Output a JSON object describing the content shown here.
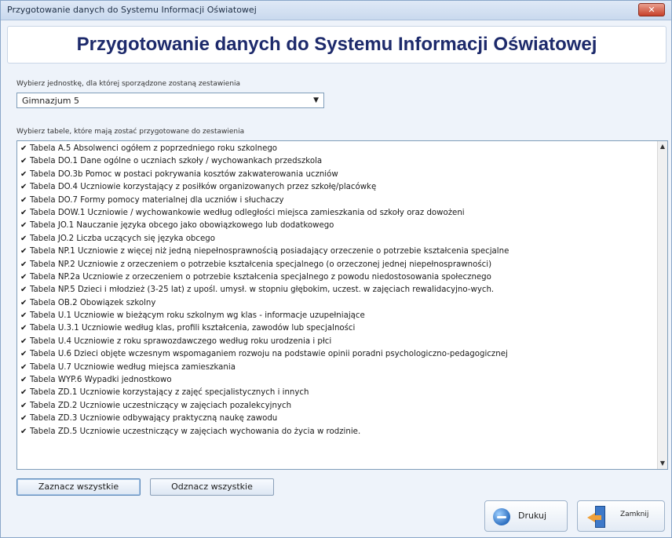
{
  "window": {
    "title": "Przygotowanie danych do Systemu Informacji Oświatowej",
    "close_icon": "close-icon"
  },
  "header": {
    "heading": "Przygotowanie danych do Systemu Informacji Oświatowej"
  },
  "unit_select": {
    "label": "Wybierz jednostkę, dla której sporządzone zostaną zestawienia",
    "value": "Gimnazjum 5"
  },
  "tables": {
    "label": "Wybierz tabele, które mają zostać przygotowane do zestawienia",
    "items": [
      {
        "checked": true,
        "label": "Tabela A.5 Absolwenci ogółem z poprzedniego roku szkolnego"
      },
      {
        "checked": true,
        "label": "Tabela DO.1 Dane ogólne o uczniach szkoły / wychowankach przedszkola"
      },
      {
        "checked": true,
        "label": "Tabela DO.3b Pomoc w postaci pokrywania kosztów zakwaterowania uczniów"
      },
      {
        "checked": true,
        "label": "Tabela DO.4 Uczniowie korzystający z posiłków organizowanych przez szkołę/placówkę"
      },
      {
        "checked": true,
        "label": "Tabela DO.7 Formy pomocy materialnej dla uczniów i słuchaczy"
      },
      {
        "checked": true,
        "label": "Tabela DOW.1 Uczniowie / wychowankowie według odległości miejsca zamieszkania od szkoły oraz dowożeni"
      },
      {
        "checked": true,
        "label": "Tabela JO.1 Nauczanie języka obcego jako obowiązkowego lub dodatkowego"
      },
      {
        "checked": true,
        "label": "Tabela JO.2 Liczba uczących się języka obcego"
      },
      {
        "checked": true,
        "label": "Tabela NP.1 Uczniowie z więcej niż jedną niepełnosprawnością posiadający orzeczenie o potrzebie kształcenia specjalne"
      },
      {
        "checked": true,
        "label": "Tabela NP.2 Uczniowie z orzeczeniem o potrzebie kształcenia specjalnego (o orzeczonej jednej niepełnosprawności)"
      },
      {
        "checked": true,
        "label": "Tabela NP.2a Uczniowie z orzeczeniem o potrzebie kształcenia specjalnego z powodu niedostosowania społecznego"
      },
      {
        "checked": true,
        "label": "Tabela NP.5 Dzieci i młodzież (3-25 lat) z upośl. umysł. w stopniu głębokim, uczest. w zajęciach rewalidacyjno-wych."
      },
      {
        "checked": true,
        "label": "Tabela OB.2 Obowiązek szkolny"
      },
      {
        "checked": true,
        "label": "Tabela U.1 Uczniowie w bieżącym roku szkolnym wg klas - informacje uzupełniające"
      },
      {
        "checked": true,
        "label": "Tabela U.3.1 Uczniowie według klas, profili kształcenia, zawodów lub specjalności"
      },
      {
        "checked": true,
        "label": "Tabela U.4 Uczniowie z roku sprawozdawczego według roku urodzenia i płci"
      },
      {
        "checked": true,
        "label": "Tabela U.6 Dzieci objęte wczesnym wspomaganiem rozwoju na podstawie opinii poradni psychologiczno-pedagogicznej"
      },
      {
        "checked": true,
        "label": "Tabela U.7 Uczniowie według miejsca zamieszkania"
      },
      {
        "checked": true,
        "label": "Tabela WYP.6 Wypadki jednostkowo"
      },
      {
        "checked": true,
        "label": "Tabela ZD.1 Uczniowie korzystający z zajęć specjalistycznych i innych"
      },
      {
        "checked": true,
        "label": "Tabela ZD.2 Uczniowie uczestniczący w zajęciach pozalekcyjnych"
      },
      {
        "checked": true,
        "label": "Tabela ZD.3 Uczniowie odbywający praktyczną naukę zawodu"
      },
      {
        "checked": true,
        "label": "Tabela ZD.5 Uczniowie uczestniczący w zajęciach wychowania do życia w rodzinie."
      }
    ]
  },
  "actions": {
    "select_all": "Zaznacz wszystkie",
    "deselect_all": "Odznacz wszystkie",
    "print": "Drukuj",
    "close": "Zamknij"
  },
  "icons": {
    "check": "checkmark-icon",
    "dropdown": "chevron-down-icon",
    "print": "print-globe-icon",
    "exit": "exit-door-icon"
  }
}
